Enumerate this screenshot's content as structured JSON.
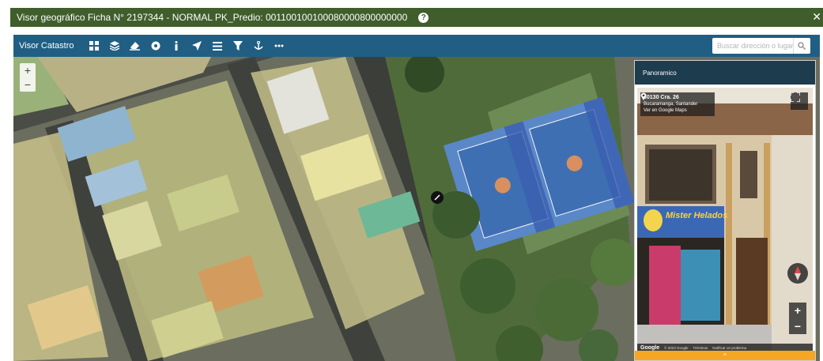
{
  "window": {
    "title": "Visor geográfico Ficha N° 2197344 - NORMAL PK_Predio: 001100100100080000800000000",
    "help_glyph": "?",
    "close_glyph": "✕"
  },
  "toolbar": {
    "title": "Visor Catastro",
    "tools": [
      "grid-icon",
      "layers-icon",
      "eraser-icon",
      "target-icon",
      "info-icon",
      "navigate-icon",
      "list-icon",
      "filter-icon",
      "anchor-icon",
      "more-icon"
    ],
    "search_placeholder": "Buscar dirección o lugar"
  },
  "map": {
    "zoom_in": "+",
    "zoom_out": "−"
  },
  "panorama": {
    "header": "Panoramico",
    "address_line1": "30130 Cra. 26",
    "address_line2": "Bucaramanga, Santander",
    "address_line3": "Ver en Google Maps",
    "shop_sign": "Mister Helados",
    "zoom_in": "+",
    "zoom_out": "−",
    "google_logo": "Google",
    "copyright": "© 2023 Google",
    "terms": "Términos",
    "report": "Notificar un problema",
    "collapse": "^"
  },
  "colors": {
    "titlebar": "#3f5e2c",
    "toolbar": "#205f83",
    "panel_header": "#1d3c4e",
    "accent": "#f5a623"
  }
}
